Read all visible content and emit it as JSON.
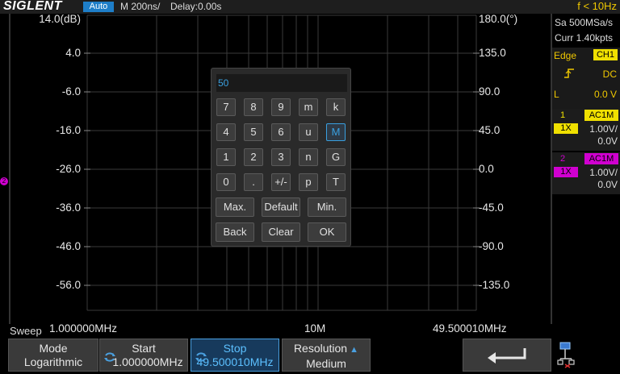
{
  "topbar": {
    "brand": "SIGLENT",
    "mode_badge": "Auto",
    "timebase": "M 200ns/",
    "delay": "Delay:0.00s",
    "freq": "f < 10Hz"
  },
  "plot": {
    "left_axis_ticks": [
      "14.0(dB)",
      "4.0",
      "-6.0",
      "-16.0",
      "-26.0",
      "-36.0",
      "-46.0",
      "-56.0"
    ],
    "right_axis_ticks": [
      "180.0(°)",
      "135.0",
      "90.0",
      "45.0",
      "0.0",
      "-45.0",
      "-90.0",
      "-135.0"
    ],
    "x_labels": [
      "1.000000MHz",
      "10M",
      "49.500010MHz"
    ],
    "ch2_marker": "2"
  },
  "right_panel": {
    "sample_rate": "Sa 500MSa/s",
    "curr": "Curr 1.40kpts",
    "trigger": {
      "type": "Edge",
      "source": "CH1",
      "slope_symbol": "⨍",
      "coupling": "DC",
      "level_label": "L",
      "level_value": "0.0 V"
    },
    "ch1": {
      "num": "1",
      "coupling": "AC1M",
      "probe": "1X",
      "volts": "1.00V/",
      "offset": "0.0V",
      "color": "#f0e000"
    },
    "ch2": {
      "num": "2",
      "coupling": "AC1M",
      "probe": "1X",
      "volts": "1.00V/",
      "offset": "0.0V",
      "color": "#d000d0"
    }
  },
  "keypad": {
    "display": "50",
    "rows": [
      [
        "7",
        "8",
        "9",
        "m",
        "k"
      ],
      [
        "4",
        "5",
        "6",
        "u",
        "M"
      ],
      [
        "1",
        "2",
        "3",
        "n",
        "G"
      ],
      [
        "0",
        ".",
        "+/-",
        "p",
        "T"
      ]
    ],
    "selected_key": "M",
    "func_row1": [
      "Max.",
      "Default",
      "Min."
    ],
    "func_row2": [
      "Back",
      "Clear",
      "OK"
    ]
  },
  "softmenu": {
    "title": "Sweep",
    "mode": {
      "label": "Mode",
      "value": "Logarithmic"
    },
    "start": {
      "label": "Start",
      "value": "1.000000MHz"
    },
    "stop": {
      "label": "Stop",
      "value": "49.500010MHz"
    },
    "resolution": {
      "label": "Resolution",
      "value": "Medium"
    },
    "back_icon": "return-arrow-icon"
  }
}
